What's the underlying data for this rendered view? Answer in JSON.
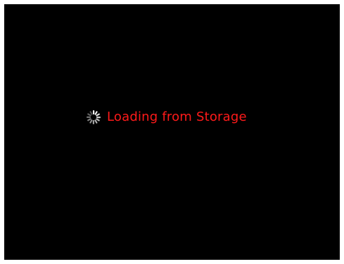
{
  "screen": {
    "background": "#000000",
    "loading": {
      "icon": "loading-spinner-icon",
      "text": "Loading from Storage",
      "text_color": "#ff1a1a",
      "spinner_color": "#ffffff"
    }
  }
}
